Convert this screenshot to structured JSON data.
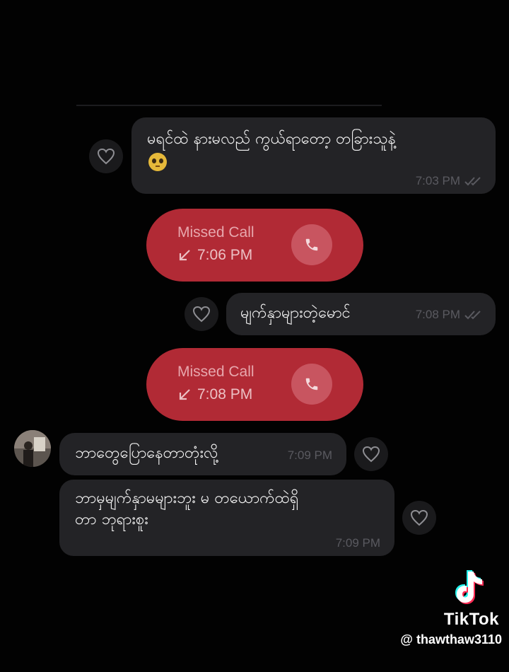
{
  "messages": [
    {
      "text": "မရင်ထဲ နားမလည် ကွယ်ရာတော့ တခြားသူနဲ့",
      "time": "7:03 PM"
    },
    {
      "text": "မျက်နှာများတဲ့မောင်",
      "time": "7:08 PM"
    },
    {
      "text": "ဘာတွေပြောနေတာတုံးလို့",
      "time": "7:09 PM"
    },
    {
      "text_line1": "ဘာမှမျက်နှာမများဘူး မ တယောက်ထဲရှိ",
      "text_line2": "တာ ဘုရားစူး",
      "time": "7:09 PM"
    }
  ],
  "calls": [
    {
      "title": "Missed Call",
      "time": "7:06 PM"
    },
    {
      "title": "Missed Call",
      "time": "7:08 PM"
    }
  ],
  "watermark": {
    "brand": "TikTok",
    "handle": "@ thawthaw3110"
  },
  "colors": {
    "background": "#020202",
    "bubble": "#232326",
    "missed_call": "#b12a35"
  }
}
